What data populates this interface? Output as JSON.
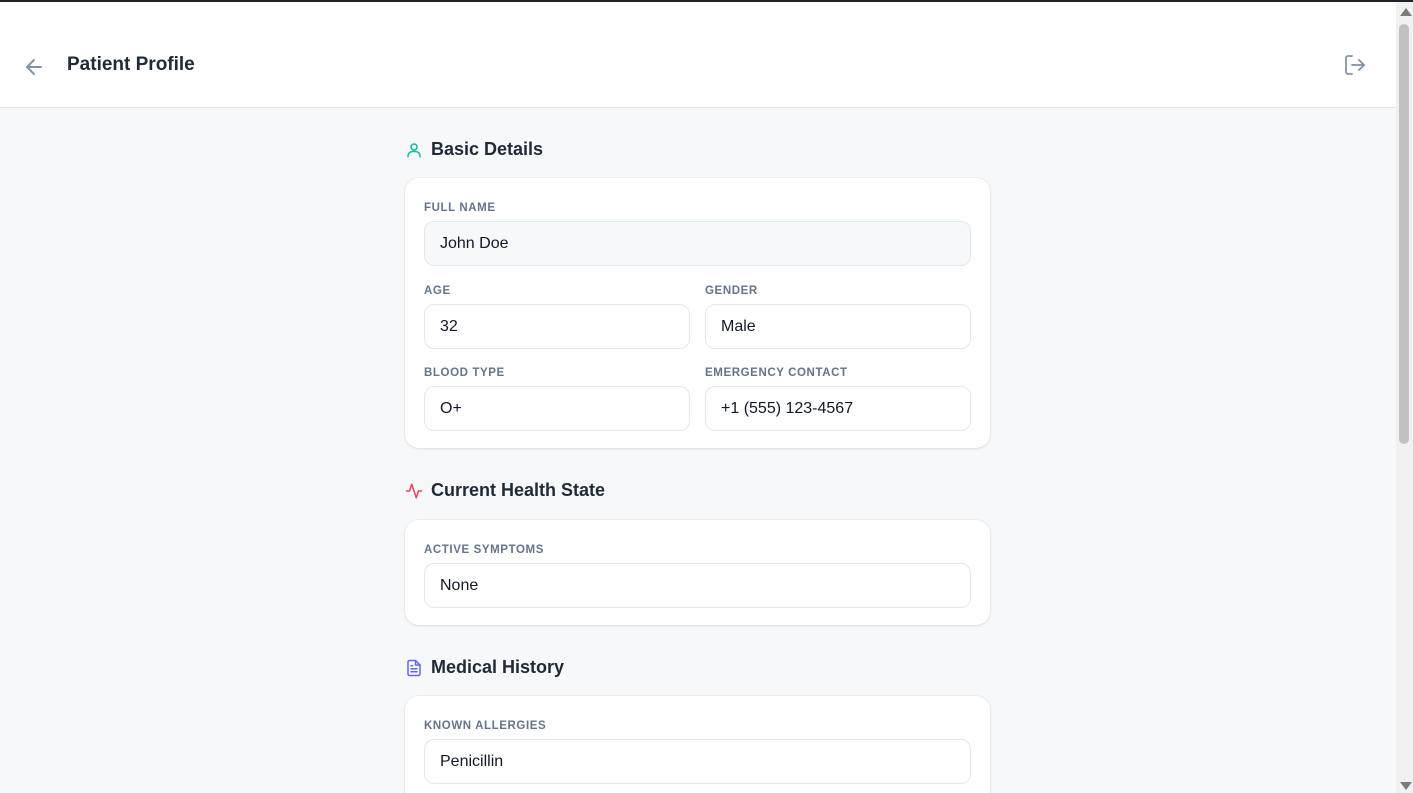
{
  "header": {
    "title": "Patient Profile",
    "back_icon": "arrow-left-icon",
    "logout_icon": "logout-icon"
  },
  "basic_details": {
    "title": "Basic Details",
    "icon": "user-icon",
    "icon_color": "#14b8a6",
    "full_name_label": "FULL NAME",
    "full_name": "John Doe",
    "age_label": "AGE",
    "age": "32",
    "gender_label": "GENDER",
    "gender": "Male",
    "blood_type_label": "BLOOD TYPE",
    "blood_type": "O+",
    "emergency_contact_label": "EMERGENCY CONTACT",
    "emergency_contact": "+1 (555) 123-4567"
  },
  "health_state": {
    "title": "Current Health State",
    "icon": "activity-icon",
    "icon_color": "#f43f5e",
    "active_symptoms_label": "ACTIVE SYMPTOMS",
    "active_symptoms": "None"
  },
  "medical_history": {
    "title": "Medical History",
    "icon": "document-icon",
    "icon_color": "#6366f1",
    "known_allergies_label": "KNOWN ALLERGIES",
    "known_allergies": "Penicillin"
  }
}
